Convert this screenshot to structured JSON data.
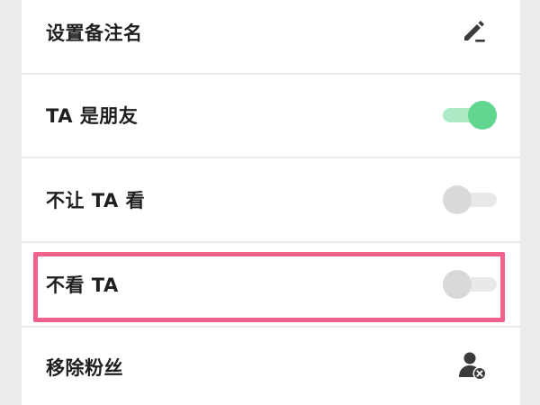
{
  "settings": {
    "items": [
      {
        "label": "设置备注名",
        "control": "edit-icon"
      },
      {
        "label": "TA 是朋友",
        "control": "toggle",
        "on": true
      },
      {
        "label": "不让 TA 看",
        "control": "toggle",
        "on": false
      },
      {
        "label": "不看 TA",
        "control": "toggle",
        "on": false
      },
      {
        "label": "移除粉丝",
        "control": "remove-user-icon"
      }
    ],
    "highlighted_item": "不看 TA"
  },
  "colors": {
    "toggle_on_knob": "#62d58e",
    "toggle_on_track": "#aee9c6",
    "toggle_off_knob": "#d9d9d9",
    "toggle_off_track": "#e9e9e9",
    "highlight_border": "#f2608c",
    "text": "#1f1f1f"
  }
}
